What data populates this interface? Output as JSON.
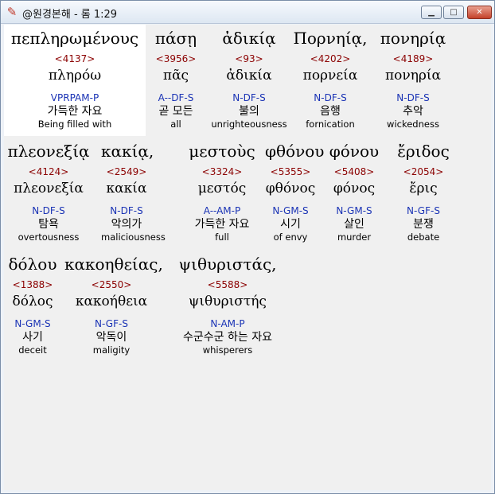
{
  "window": {
    "title": "@원경본해 - 롬 1:29",
    "icon": "book-icon",
    "controls": {
      "minimize": "minimize-icon",
      "maximize": "maximize-icon",
      "close": "close-icon"
    }
  },
  "colors": {
    "strongs": "#8b0000",
    "morph": "#1a33b5",
    "highlight": "#ffffff"
  },
  "rows": [
    {
      "words": [
        {
          "greek": "πεπληρωμένους",
          "strongs": "<4137>",
          "lemma": "πληρόω",
          "morph": "VPRPAM-P",
          "korean": "가득한 자요",
          "english": "Being filled with"
        },
        {
          "greek": "πάσῃ",
          "strongs": "<3956>",
          "lemma": "πᾶς",
          "morph": "A--DF-S",
          "korean": "곧 모든",
          "english": "all"
        },
        {
          "greek": "ἀδικίᾳ",
          "strongs": "<93>",
          "lemma": "ἀδικία",
          "morph": "N-DF-S",
          "korean": "불의",
          "english": "unrighteousness"
        },
        {
          "greek": "Πορνηίᾳ,",
          "strongs": "<4202>",
          "lemma": "πορνεία",
          "morph": "N-DF-S",
          "korean": "음행",
          "english": "fornication"
        },
        {
          "greek": "πονηρίᾳ",
          "strongs": "<4189>",
          "lemma": "πονηρία",
          "morph": "N-DF-S",
          "korean": "추악",
          "english": "wickedness"
        }
      ]
    },
    {
      "words": [
        {
          "greek": "πλεονεξίᾳ",
          "strongs": "<4124>",
          "lemma": "πλεονεξία",
          "morph": "N-DF-S",
          "korean": "탐욕",
          "english": "overtousness"
        },
        {
          "greek": "κακίᾳ,",
          "strongs": "<2549>",
          "lemma": "κακία",
          "morph": "N-DF-S",
          "korean": "악의가",
          "english": "maliciousness"
        },
        {
          "greek": "μεστοὺς",
          "strongs": "<3324>",
          "lemma": "μεστός",
          "morph": "A--AM-P",
          "korean": "가득한 자요",
          "english": "full"
        },
        {
          "greek": "φθόνου",
          "strongs": "<5355>",
          "lemma": "φθόνος",
          "morph": "N-GM-S",
          "korean": "시기",
          "english": "of envy"
        },
        {
          "greek": "φόνου",
          "strongs": "<5408>",
          "lemma": "φόνος",
          "morph": "N-GM-S",
          "korean": "살인",
          "english": "murder"
        },
        {
          "greek": "ἔριδος",
          "strongs": "<2054>",
          "lemma": "ἔρις",
          "morph": "N-GF-S",
          "korean": "분쟁",
          "english": "debate"
        }
      ]
    },
    {
      "words": [
        {
          "greek": "δόλου",
          "strongs": "<1388>",
          "lemma": "δόλος",
          "morph": "N-GM-S",
          "korean": "사기",
          "english": "deceit"
        },
        {
          "greek": "κακοηθείας,",
          "strongs": "<2550>",
          "lemma": "κακοήθεια",
          "morph": "N-GF-S",
          "korean": "악독이",
          "english": "maligity"
        },
        {
          "greek": "ψιθυριστάς,",
          "strongs": "<5588>",
          "lemma": "ψιθυριστής",
          "morph": "N-AM-P",
          "korean": "수군수군 하는 자요",
          "english": "whisperers"
        }
      ]
    }
  ]
}
